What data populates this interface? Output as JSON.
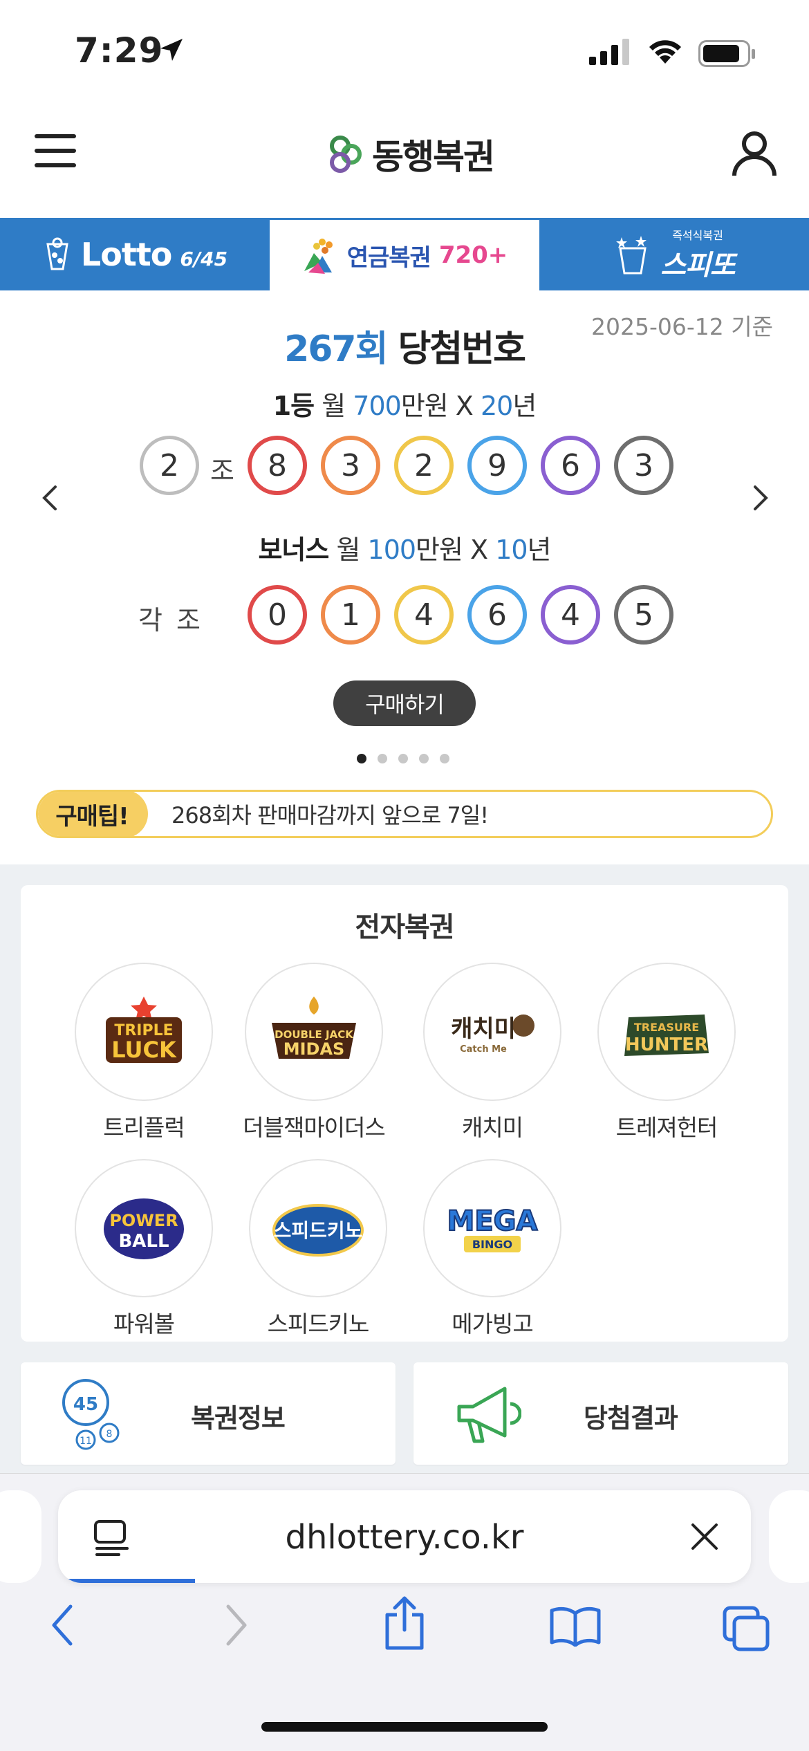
{
  "status": {
    "time": "7:29"
  },
  "header": {
    "logo": "동행복권"
  },
  "tabs": {
    "lotto": {
      "label": "Lotto",
      "sub": "6/45"
    },
    "pension": {
      "label": "연금복권",
      "num": "720+"
    },
    "speeto": {
      "small": "즉석식복권",
      "label": "스피또"
    }
  },
  "draw": {
    "date": "2025-06-12 기준",
    "round": "267회",
    "title_suffix": "당첨번호",
    "first": {
      "rank": "1등",
      "pre": "월",
      "amount": "700",
      "unit": "만원 X",
      "years": "20",
      "year_unit": "년"
    },
    "group_number": "2",
    "group_label": "조",
    "first_numbers": [
      "8",
      "3",
      "2",
      "9",
      "6",
      "3"
    ],
    "bonus": {
      "rank": "보너스",
      "pre": "월",
      "amount": "100",
      "unit": "만원 X",
      "years": "10",
      "year_unit": "년"
    },
    "each_label": "각 조",
    "bonus_numbers": [
      "0",
      "1",
      "4",
      "6",
      "4",
      "5"
    ],
    "ball_colors": [
      "#e04a4a",
      "#ef8a4a",
      "#f0c74a",
      "#4aa3e8",
      "#8a5fd1",
      "#6e6e6e"
    ]
  },
  "buy_button": "구매하기",
  "carousel": {
    "page": 1,
    "total": 5
  },
  "tip": {
    "label": "구매팁!",
    "text": "268회차 판매마감까지 앞으로 7일!"
  },
  "elottery": {
    "title": "전자복권",
    "games": [
      {
        "name": "트리플럭",
        "logo": [
          "TRIPLE",
          "LUCK"
        ]
      },
      {
        "name": "더블잭마이더스",
        "logo": [
          "DOUBLE JACK",
          "MIDAS"
        ]
      },
      {
        "name": "캐치미",
        "logo": [
          "캐치미",
          "Catch Me"
        ]
      },
      {
        "name": "트레져헌터",
        "logo": [
          "TREASURE",
          "HUNTER"
        ]
      },
      {
        "name": "파워볼",
        "logo": [
          "POWER",
          "BALL"
        ]
      },
      {
        "name": "스피드키노",
        "logo": [
          "스피드키노",
          ""
        ]
      },
      {
        "name": "메가빙고",
        "logo": [
          "MEGA",
          "BINGO"
        ]
      }
    ]
  },
  "info_cards": [
    {
      "label": "복권정보",
      "icon": "lottery-balls-icon",
      "ball_numbers": [
        "45",
        "11",
        "8"
      ]
    },
    {
      "label": "당첨결과",
      "icon": "megaphone-icon"
    }
  ],
  "browser": {
    "url": "dhlottery.co.kr"
  }
}
